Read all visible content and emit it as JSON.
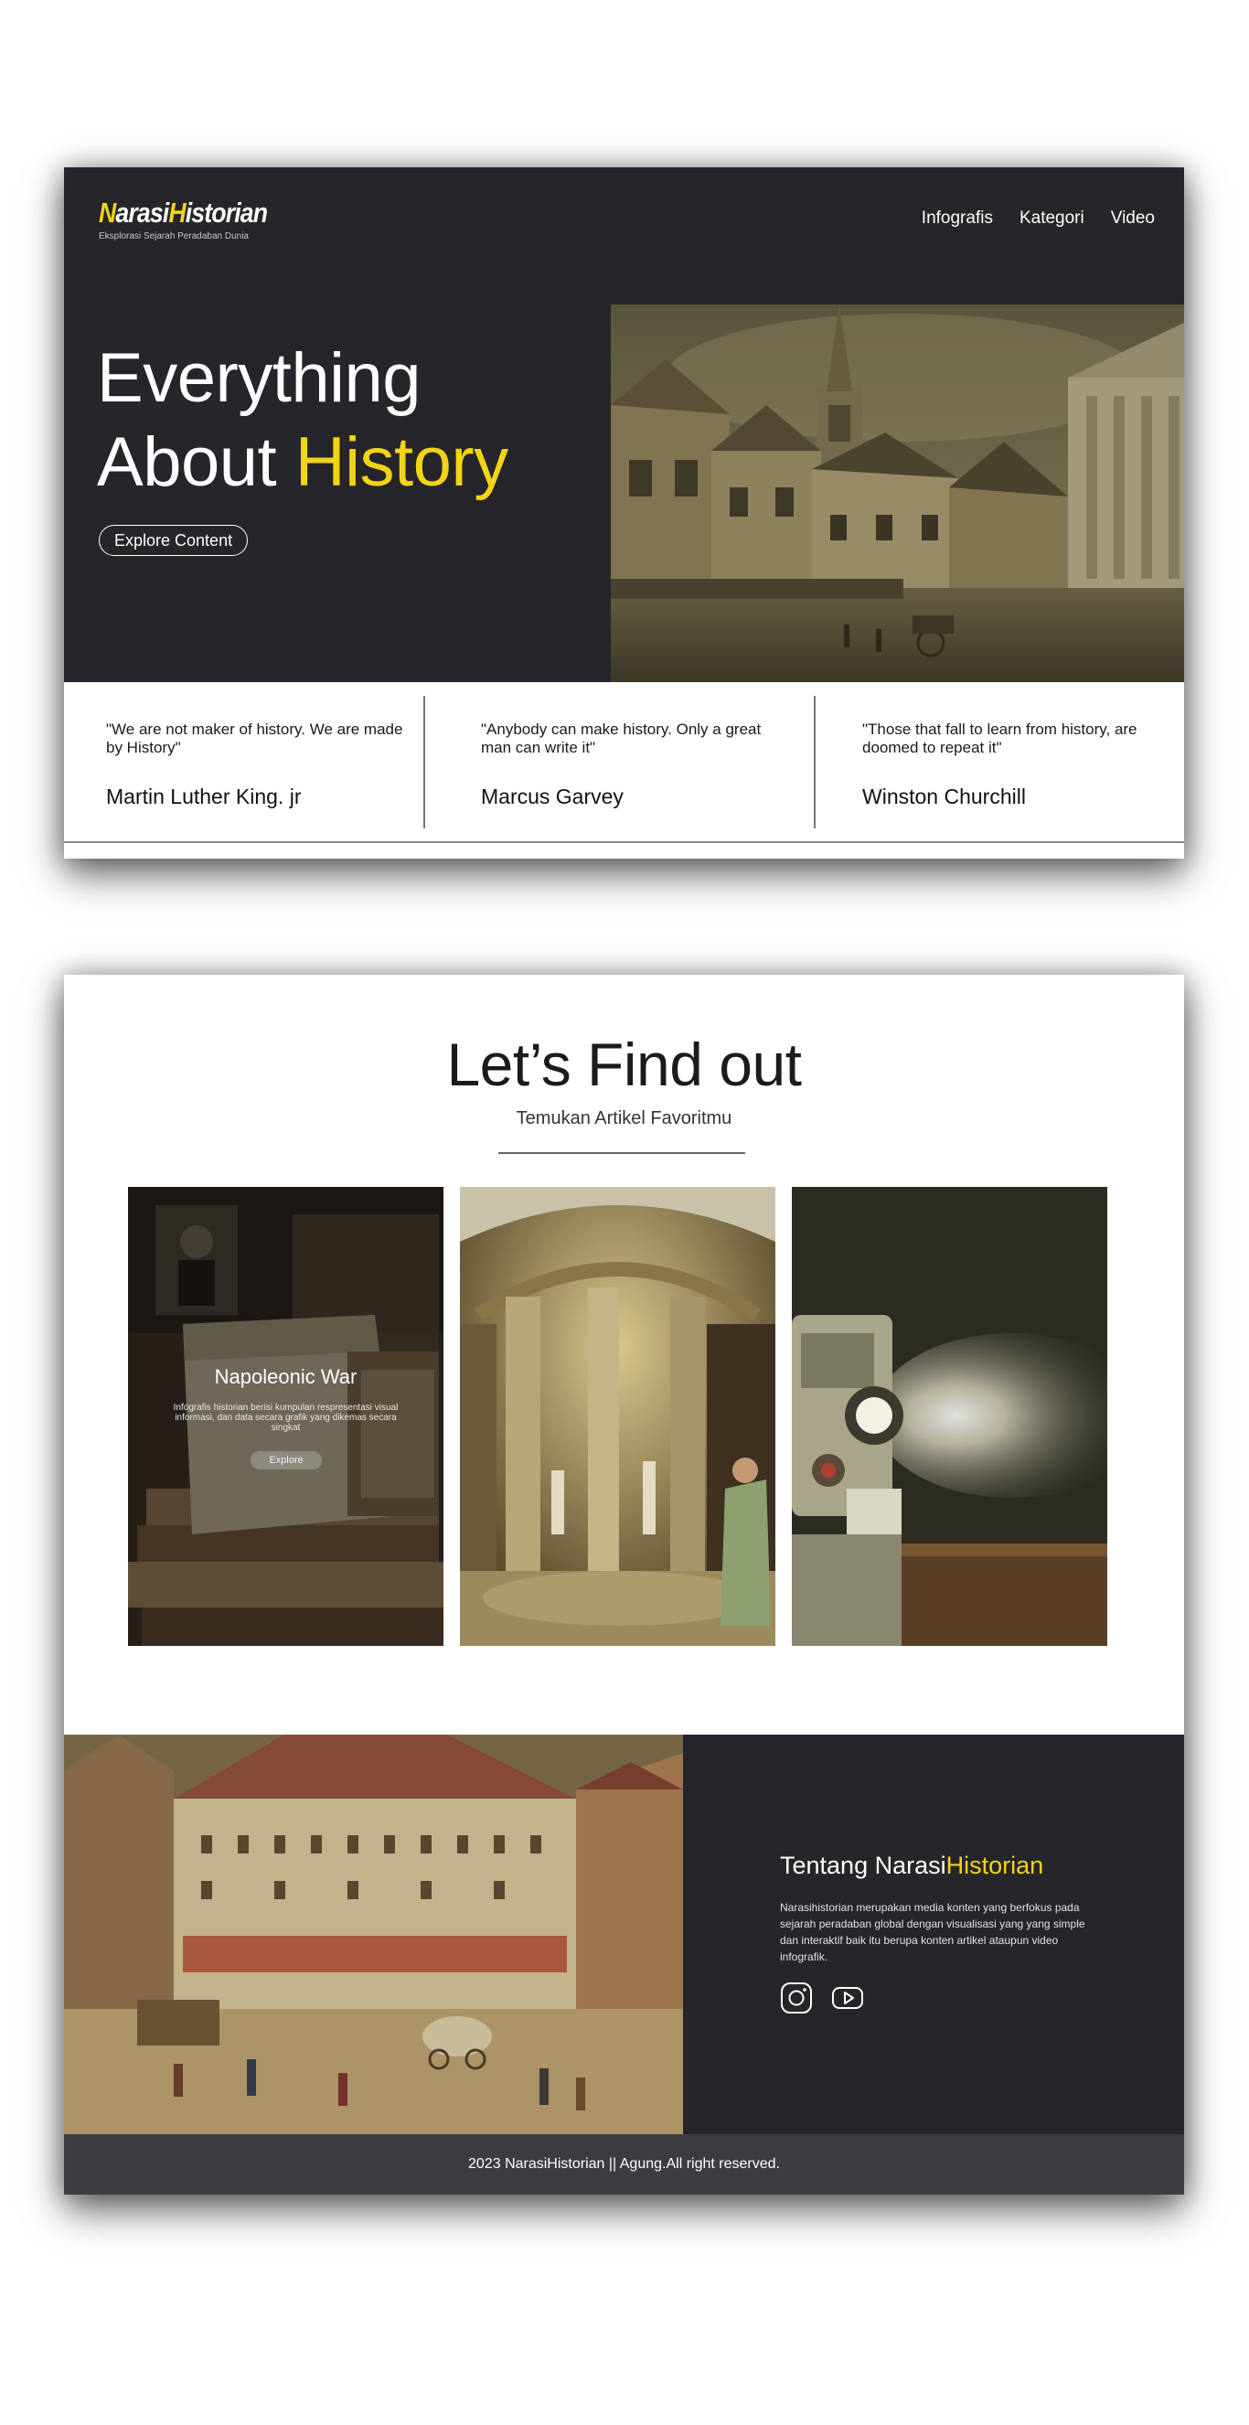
{
  "brand": {
    "name_part1": "Narasi",
    "name_part2": "Historian",
    "tagline": "Eksplorasi Sejarah Peradaban Dunia"
  },
  "nav": {
    "items": [
      "Infografis",
      "Kategori",
      "Video"
    ]
  },
  "hero": {
    "title_line1": "Everything",
    "title_line2_prefix": "About ",
    "title_line2_accent": "History",
    "cta_label": "Explore Content"
  },
  "quotes": [
    {
      "text": "\"We are not maker of history. We are made by History\"",
      "author": "Martin Luther King. jr"
    },
    {
      "text": "\"Anybody can make history. Only a great man can write it\"",
      "author": "Marcus Garvey"
    },
    {
      "text": "\"Those that fall to learn from history, are doomed to repeat it\"",
      "author": "Winston Churchill"
    }
  ],
  "find": {
    "title": "Let’s Find out",
    "subtitle": "Temukan Artikel Favoritmu"
  },
  "tiles": [
    {
      "title": "Napoleonic War",
      "description": "Infografis historian berisi kumpulan respresentasi visual informasi, dan data secara grafik yang dikemas secara singkat",
      "button_label": "Explore"
    }
  ],
  "about": {
    "title_prefix": "Tentang Narasi",
    "title_accent": "Historian",
    "text": "Narasihistorian merupakan media konten yang berfokus pada sejarah peradaban global dengan visualisasi yang yang simple dan interaktif baik itu berupa konten artikel ataupun video infografik.",
    "social_icons": [
      "instagram-icon",
      "youtube-icon"
    ]
  },
  "footer": {
    "text": "2023 NarasiHistorian || Agung.All right reserved."
  },
  "colors": {
    "dark_bg": "#25252a",
    "accent_yellow": "#f2d417",
    "footer_bg": "#3c3c43"
  }
}
